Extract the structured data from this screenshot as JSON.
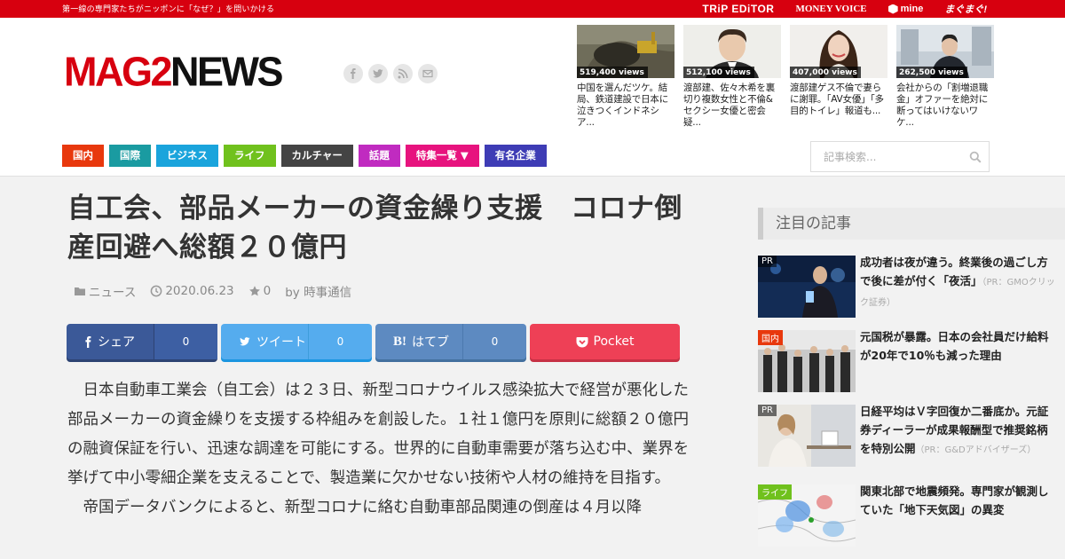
{
  "topbar": {
    "tagline": "第一線の専門家たちがニッポンに「なぜ？」を問いかける",
    "partners": [
      "TRiP EDiTOR",
      "MONEY VOICE",
      "mine",
      "まぐまぐ!"
    ]
  },
  "header": {
    "logo_mag2": "MAG2",
    "logo_news": "NEWS",
    "social_icons": [
      "facebook-icon",
      "twitter-icon",
      "rss-icon",
      "mail-icon"
    ]
  },
  "popular": [
    {
      "views": "519,400 views",
      "title": "中国を選んだツケ。結局、鉄道建設で日本に泣きつくインドネシア..."
    },
    {
      "views": "512,100 views",
      "title": "渡部建、佐々木希を裏切り複数女性と不倫&セクシー女優と密会疑..."
    },
    {
      "views": "407,000 views",
      "title": "渡部建ゲス不倫で妻らに謝罪。「AV女優」「多目的トイレ」報道も..."
    },
    {
      "views": "262,500 views",
      "title": "会社からの「割増退職金」オファーを絶対に断ってはいけないワケ..."
    }
  ],
  "nav": [
    {
      "label": "国内",
      "color": "#e8380d"
    },
    {
      "label": "国際",
      "color": "#1a9ba1"
    },
    {
      "label": "ビジネス",
      "color": "#1aa4dc"
    },
    {
      "label": "ライフ",
      "color": "#70c11d"
    },
    {
      "label": "カルチャー",
      "color": "#444444"
    },
    {
      "label": "話題",
      "color": "#c02bc0"
    },
    {
      "label": "特集一覧 ▼",
      "color": "#e7137e"
    },
    {
      "label": "有名企業",
      "color": "#3e3cb5"
    }
  ],
  "search": {
    "placeholder": "記事検索..."
  },
  "article": {
    "title": "自工会、部品メーカーの資金繰り支援　コロナ倒産回避へ総額２０億円",
    "category": "ニュース",
    "date": "2020.06.23",
    "stars": "0",
    "author": "by 時事通信",
    "paragraphs": [
      "日本自動車工業会（自工会）は２３日、新型コロナウイルス感染拡大で経営が悪化した部品メーカーの資金繰りを支援する枠組みを創設した。１社１億円を原則に総額２０億円の融資保証を行い、迅速な調達を可能にする。世界的に自動車需要が落ち込む中、業界を挙げて中小零細企業を支えることで、製造業に欠かせない技術や人材の維持を目指す。",
      "帝国データバンクによると、新型コロナに絡む自動車部品関連の倒産は４月以降"
    ]
  },
  "share": {
    "facebook": {
      "label": "シェア",
      "count": "0"
    },
    "twitter": {
      "label": "ツイート",
      "count": "0"
    },
    "hatena": {
      "label": "はてブ",
      "icon_text": "B!",
      "count": "0"
    },
    "pocket": {
      "label": "Pocket"
    }
  },
  "sidebar": {
    "heading": "注目の記事",
    "items": [
      {
        "tag": "PR",
        "title": "成功者は夜が違う。終業後の過ごし方で後に差が付く「夜活」",
        "pr": "（PR：GMOクリック証券）"
      },
      {
        "tag": "国内",
        "title": "元国税が暴露。日本の会社員だけ給料が20年で10％も減った理由",
        "pr": ""
      },
      {
        "tag": "PR",
        "title": "日経平均はＶ字回復か二番底か。元証券ディーラーが成果報酬型で推奨銘柄を特別公開",
        "pr": "（PR：G&Dアドバイザーズ）"
      },
      {
        "tag": "ライフ",
        "title": "関東北部で地震頻発。専門家が観測していた「地下天気図」の異変",
        "pr": ""
      }
    ]
  }
}
